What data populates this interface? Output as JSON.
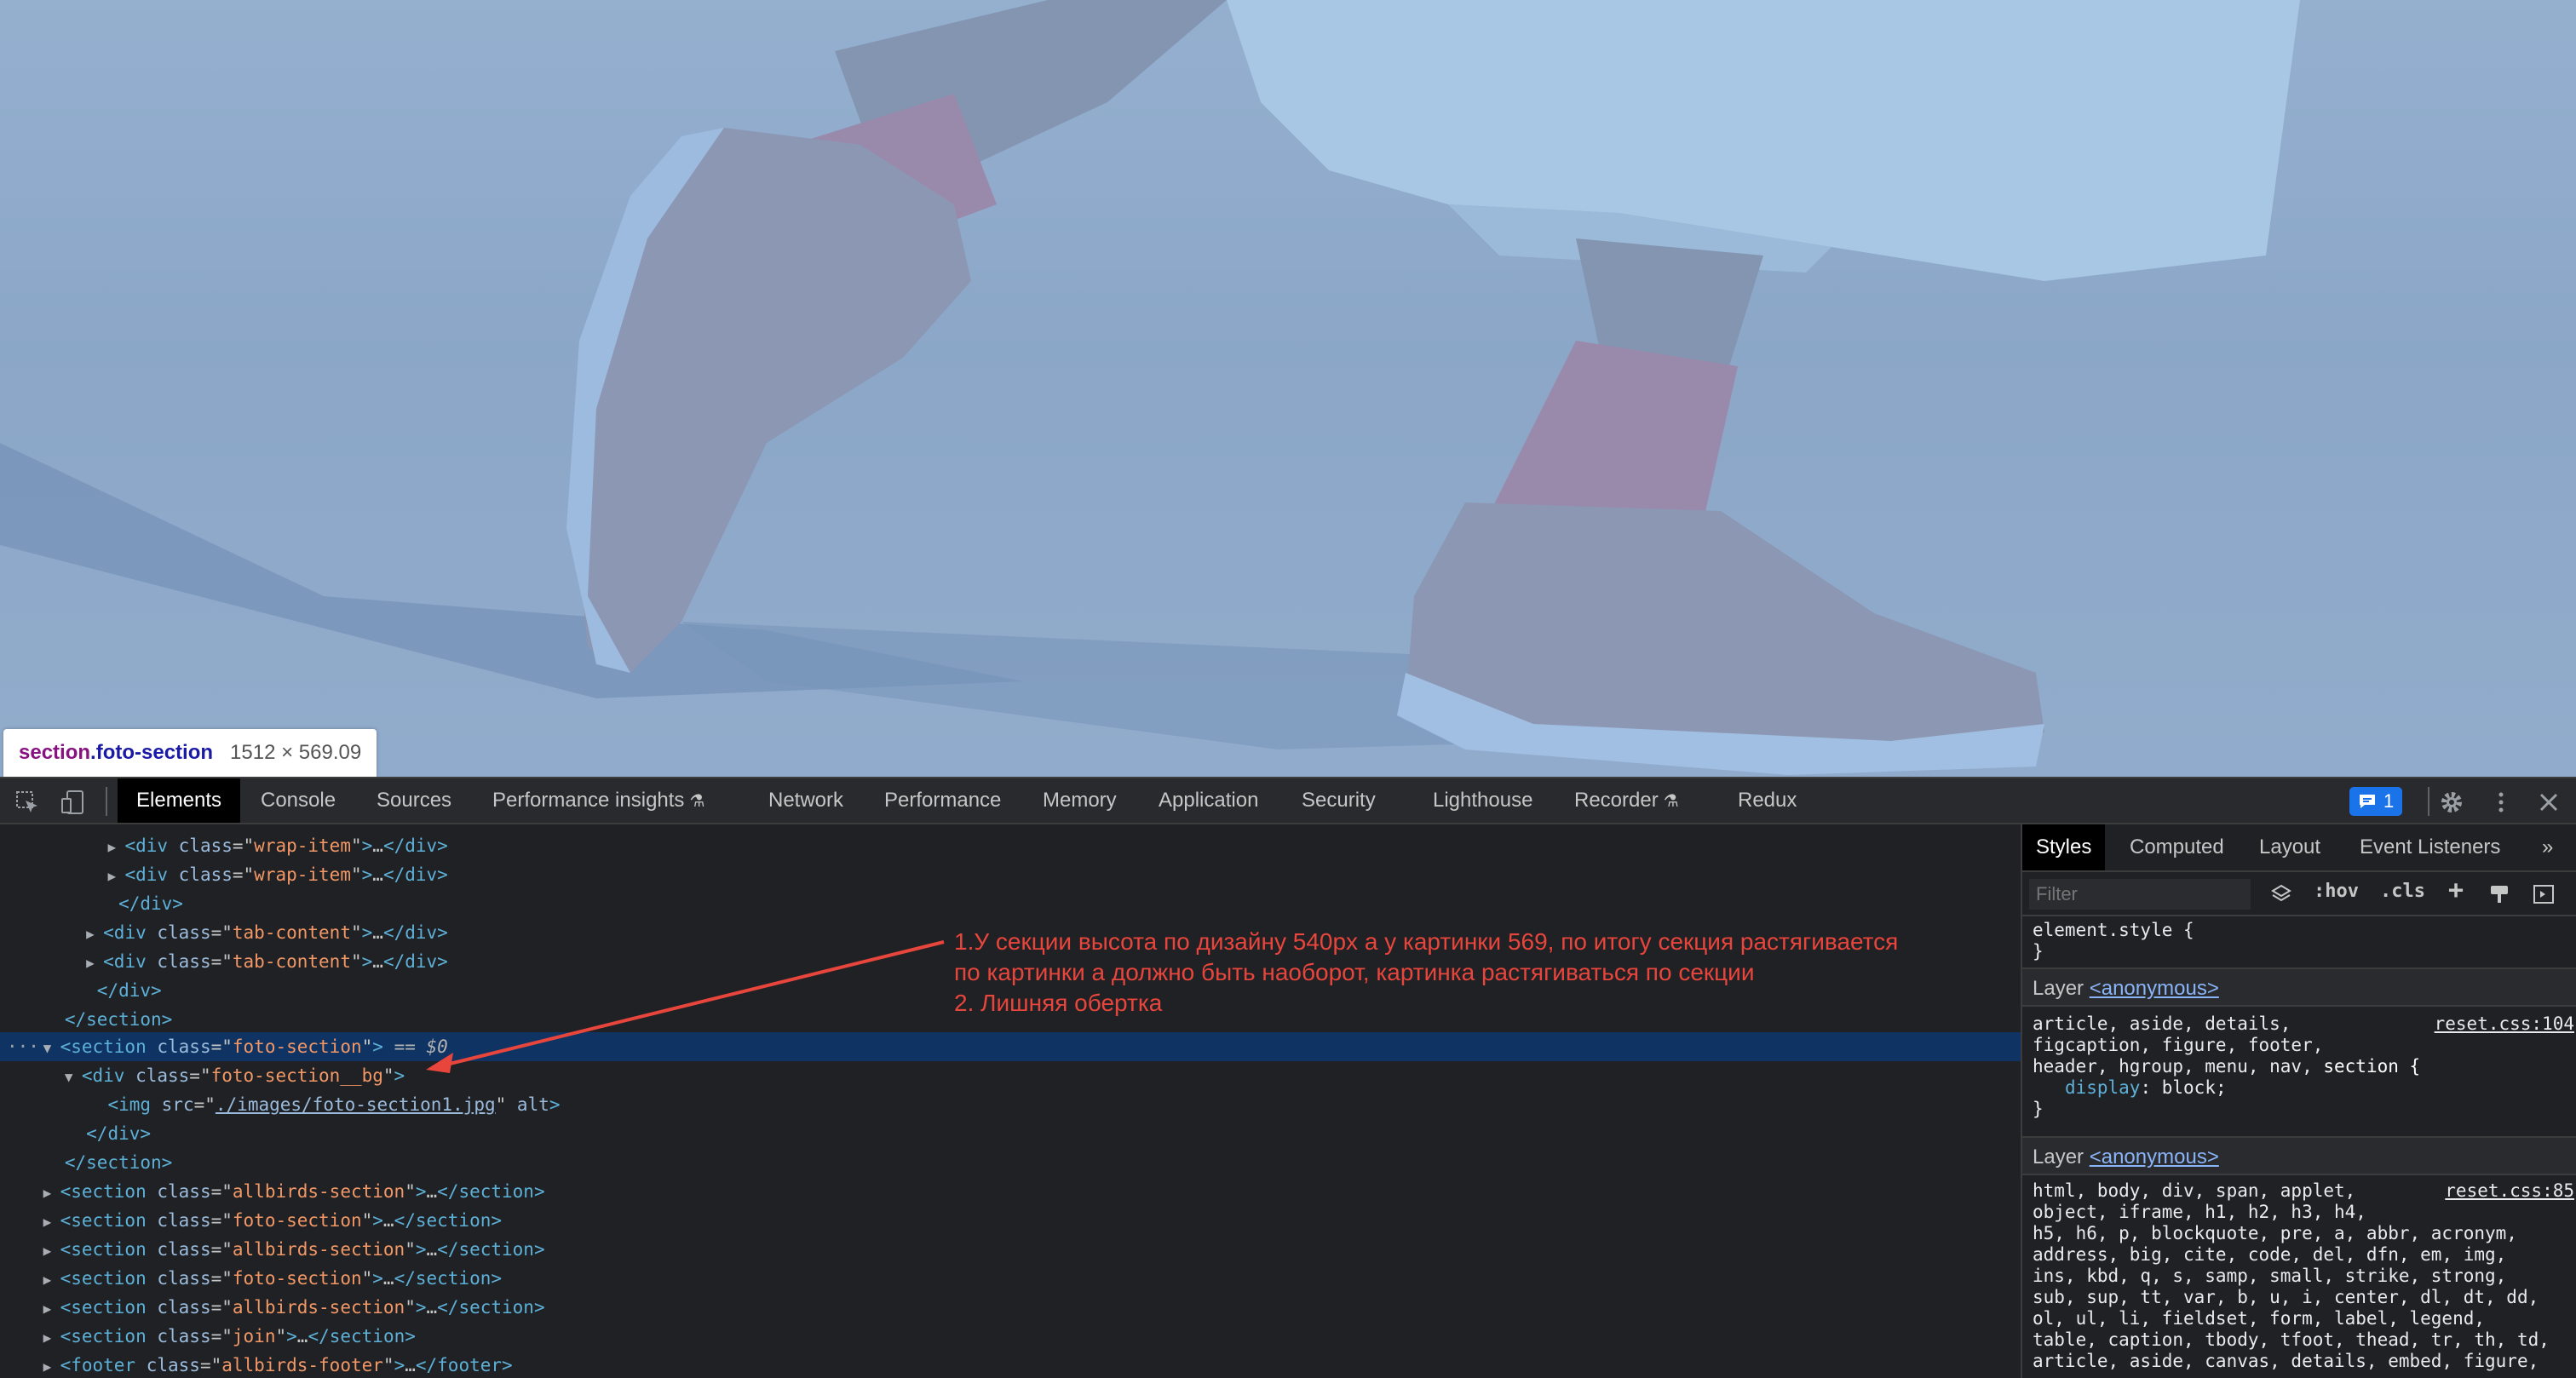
{
  "tooltip": {
    "tag": "section",
    "cls": ".foto-section",
    "size": "1512 × 569.09"
  },
  "toolbar": {
    "tabs": [
      "Elements",
      "Console",
      "Sources",
      "Performance insights",
      "Network",
      "Performance",
      "Memory",
      "Application",
      "Security",
      "Lighthouse",
      "Recorder",
      "Redux"
    ],
    "issues_count": "1",
    "icons": [
      "inspect-icon",
      "device-toggle-icon",
      "flask-icon",
      "issues-icon",
      "gear-icon",
      "more-vert-icon",
      "close-icon"
    ]
  },
  "elements": {
    "rows": [
      {
        "indent": "wrap",
        "html": "<div class=\"wrap-item\">…</div>"
      },
      {
        "indent": "wrap",
        "html": "<div class=\"wrap-item\">…</div>"
      },
      {
        "indent": "",
        "html": "</div>"
      },
      {
        "indent": "",
        "html": "<div class=\"tab-content\">…</div>"
      },
      {
        "indent": "",
        "html": "<div class=\"tab-content\">…</div>"
      },
      {
        "indent": "",
        "html": "</div>"
      },
      {
        "indent": "",
        "html": "</section>"
      },
      {
        "indent": "",
        "html": "<section class=\"foto-section\"> == $0"
      },
      {
        "indent": "",
        "html": "<div class=\"foto-section__bg\">"
      },
      {
        "indent": "",
        "html": "<img src=\"./images/foto-section1.jpg\" alt>"
      },
      {
        "indent": "",
        "html": "</div>"
      },
      {
        "indent": "",
        "html": "</section>"
      },
      {
        "indent": "",
        "html": "<section class=\"allbirds-section\">…</section>"
      },
      {
        "indent": "",
        "html": "<section class=\"foto-section\">…</section>"
      },
      {
        "indent": "",
        "html": "<section class=\"allbirds-section\">…</section>"
      },
      {
        "indent": "",
        "html": "<section class=\"foto-section\">…</section>"
      },
      {
        "indent": "",
        "html": "<section class=\"allbirds-section\">…</section>"
      },
      {
        "indent": "",
        "html": "<section class=\"join\">…</section>"
      },
      {
        "indent": "",
        "html": "<footer class=\"allbirds-footer\">…</footer>"
      }
    ],
    "annotation": [
      "1.У секции высота по дизайну 540px а у картинки 569, по итогу секция растягивается",
      "по картинки а должно быть наоборот, картинка растягиваться по секции",
      "2. Лишняя обертка"
    ],
    "annotation_color": "#e8453c"
  },
  "styles": {
    "tabs": [
      "Styles",
      "Computed",
      "Layout",
      "Event Listeners"
    ],
    "filter_placeholder": "Filter",
    "hov": ":hov",
    "cls": ".cls",
    "element_style": "element.style {",
    "close_brace": "}",
    "layer_label": "Layer",
    "layer_link": "<anonymous>",
    "rule1_source": "reset.css:104",
    "rule1_selectors": [
      "article, aside, details,",
      "figcaption, figure, footer,",
      "header, hgroup, menu, nav, "
    ],
    "rule1_last": "section {",
    "rule1_prop": "display",
    "rule1_val": "block;",
    "rule2_source": "reset.css:85",
    "rule2_lines": [
      "html, body, div, span, applet,",
      "object, iframe, h1, h2, h3, h4,",
      "h5, h6, p, blockquote, pre, a, abbr, acronym,",
      "address, big, cite, code, del, dfn, em, img,",
      "ins, kbd, q, s, samp, small, strike, strong,",
      "sub, sup, tt, var, b, u, i, center, dl, dt, dd,",
      "ol, ul, li, fieldset, form, label, legend,",
      "table, caption, tbody, tfoot, thead, tr, th, td,",
      "article, aside, canvas, details, embed, figure,"
    ]
  }
}
